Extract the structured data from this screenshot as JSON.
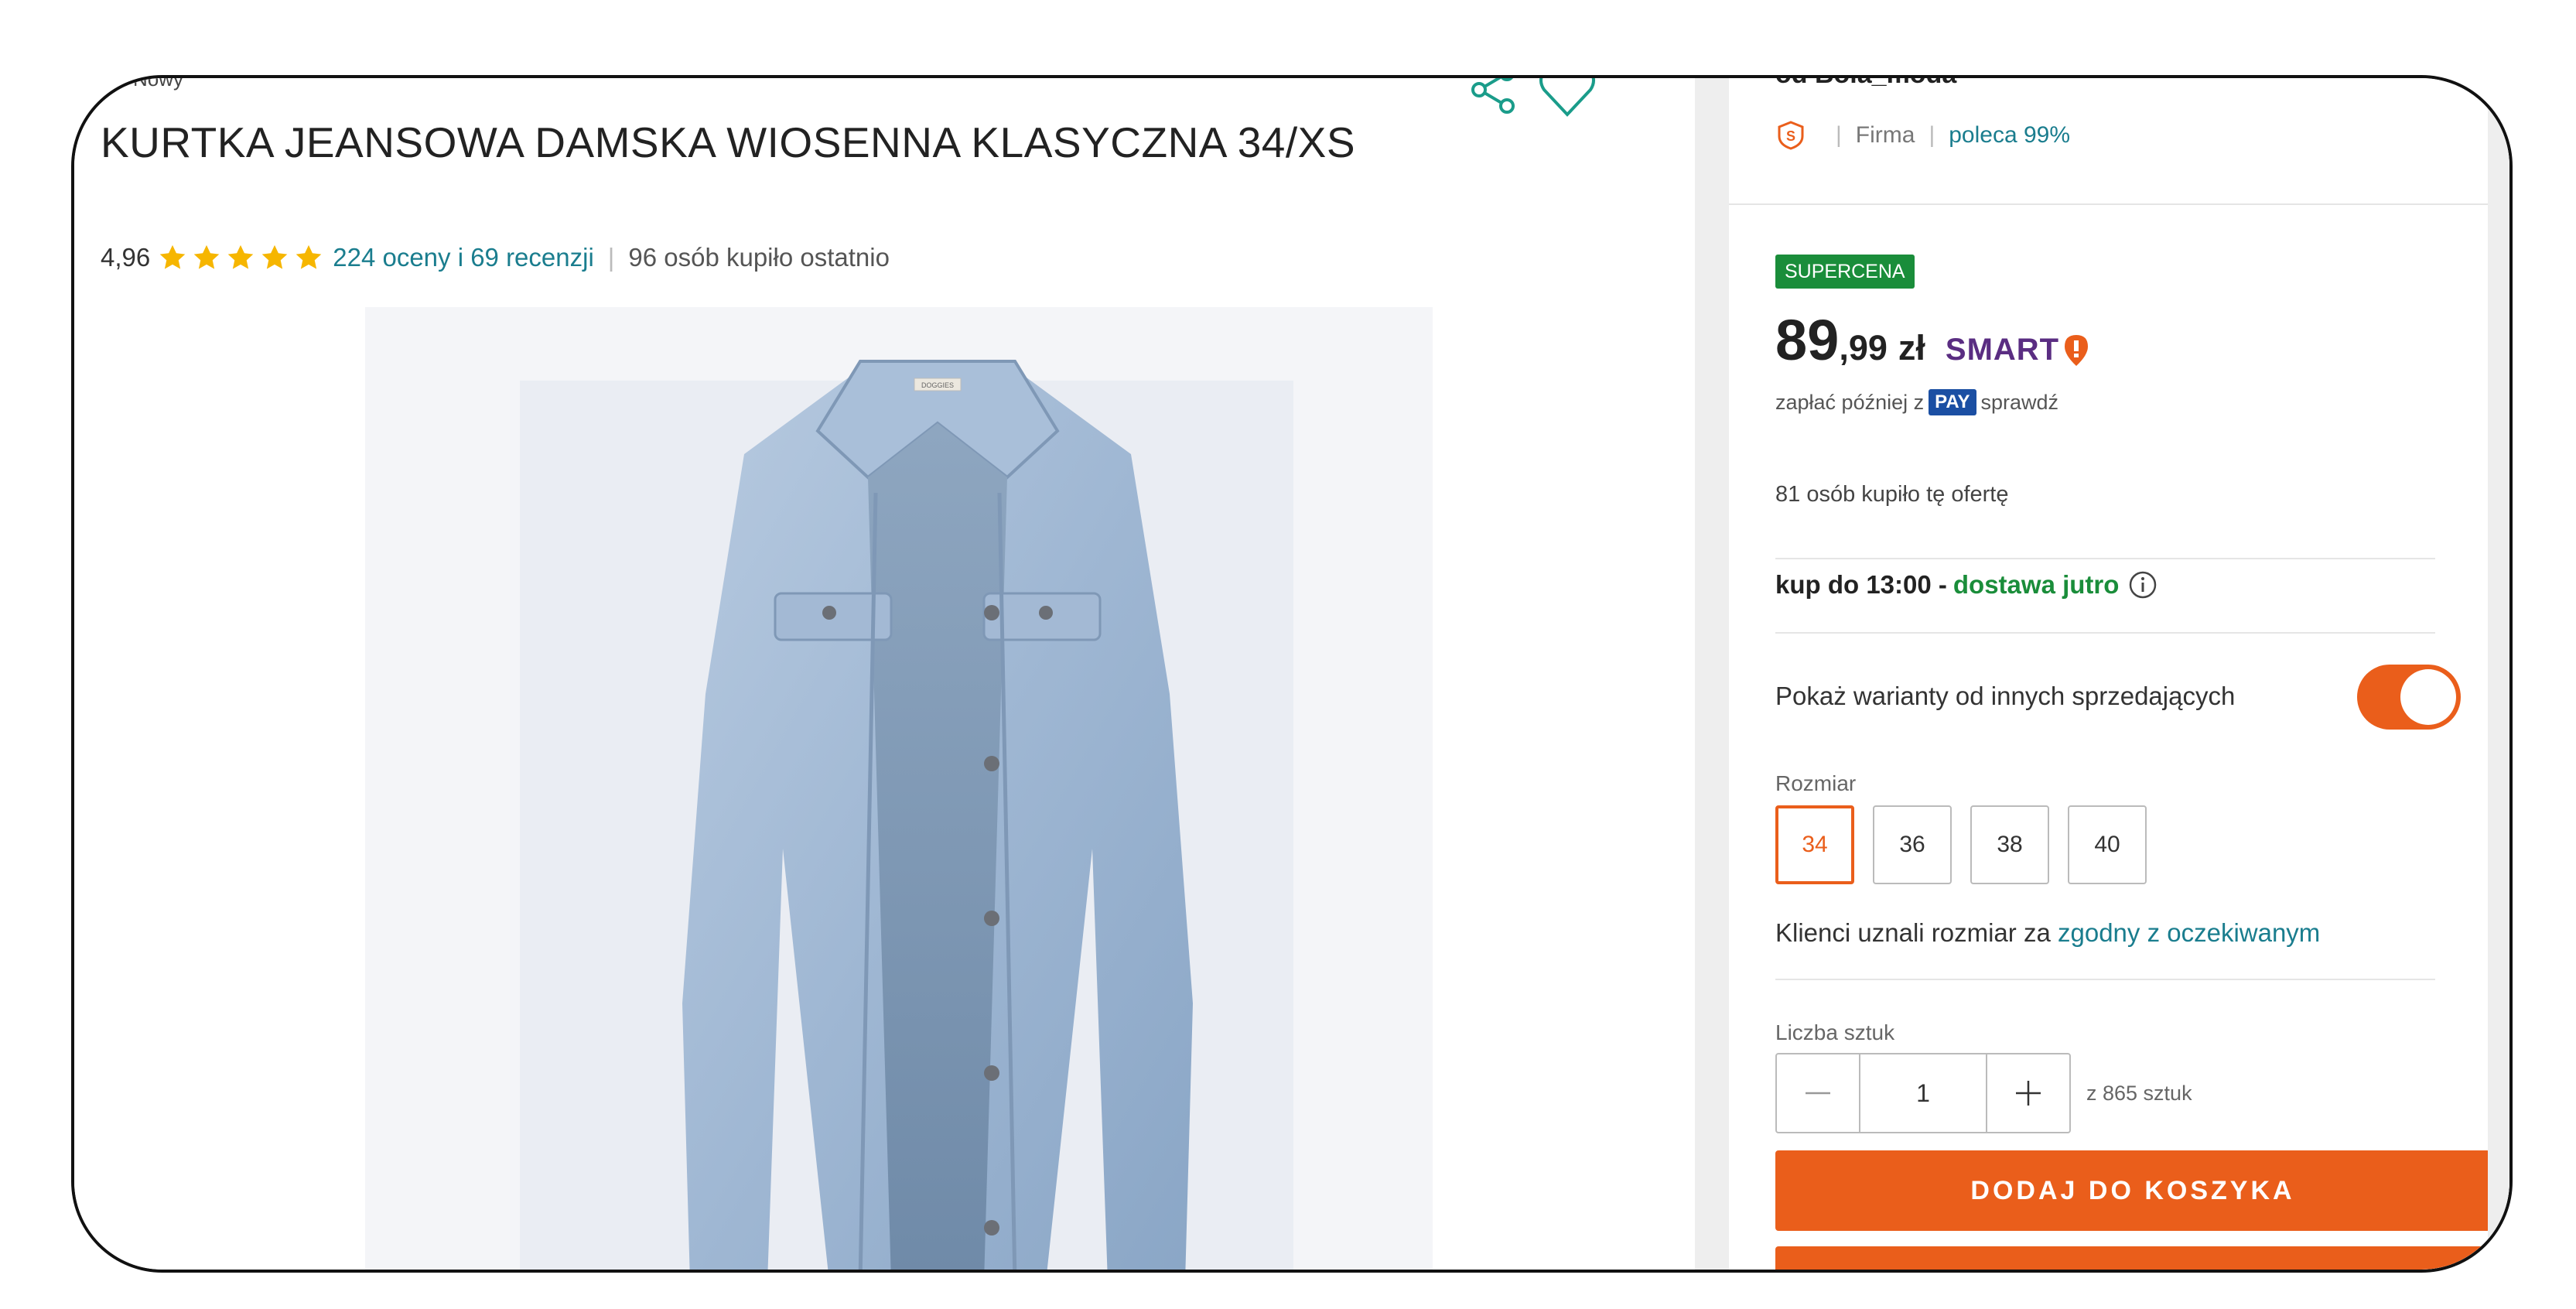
{
  "product": {
    "condition": "Nowy",
    "title": "KURTKA JEANSOWA DAMSKA WIOSENNA KLASYCZNA 34/XS",
    "rating": "4,96",
    "stars": 5,
    "reviews_link": "224 oceny i 69 recenzji",
    "recent_buyers": "96 osób kupiło ostatnio",
    "image_brand_tag": "DOGGIES"
  },
  "seller": {
    "name": "od Bola_moda",
    "type": "Firma",
    "recommend": "poleca 99%"
  },
  "offer": {
    "badge": "SUPERCENA",
    "price_int": "89",
    "price_dec": ",99",
    "currency": "zł",
    "smart_label": "SMART",
    "pay_later_prefix": "zapłać później z",
    "pay_badge": "PAY",
    "pay_later_link": "sprawdź",
    "bought_offer": "81 osób kupiło tę ofertę",
    "delivery_prefix": "kup do 13:00 -",
    "delivery_highlight": "dostawa jutro",
    "variants_label": "Pokaż warianty od innych sprzedających",
    "variants_toggle_on": true
  },
  "size": {
    "label": "Rozmiar",
    "options": [
      "34",
      "36",
      "38",
      "40"
    ],
    "selected": "34",
    "fit_prefix": "Klienci uznali rozmiar za",
    "fit_link": "zgodny z oczekiwanym"
  },
  "quantity": {
    "label": "Liczba sztuk",
    "value": "1",
    "total": "z 865 sztuk"
  },
  "actions": {
    "add_to_cart": "DODAJ DO KOSZYKA"
  },
  "colors": {
    "accent_orange": "#ea5e1b",
    "link_teal": "#1a7d8e",
    "success_green": "#1a8d3a",
    "smart_purple": "#5a2d82",
    "star_yellow": "#f6b600"
  }
}
